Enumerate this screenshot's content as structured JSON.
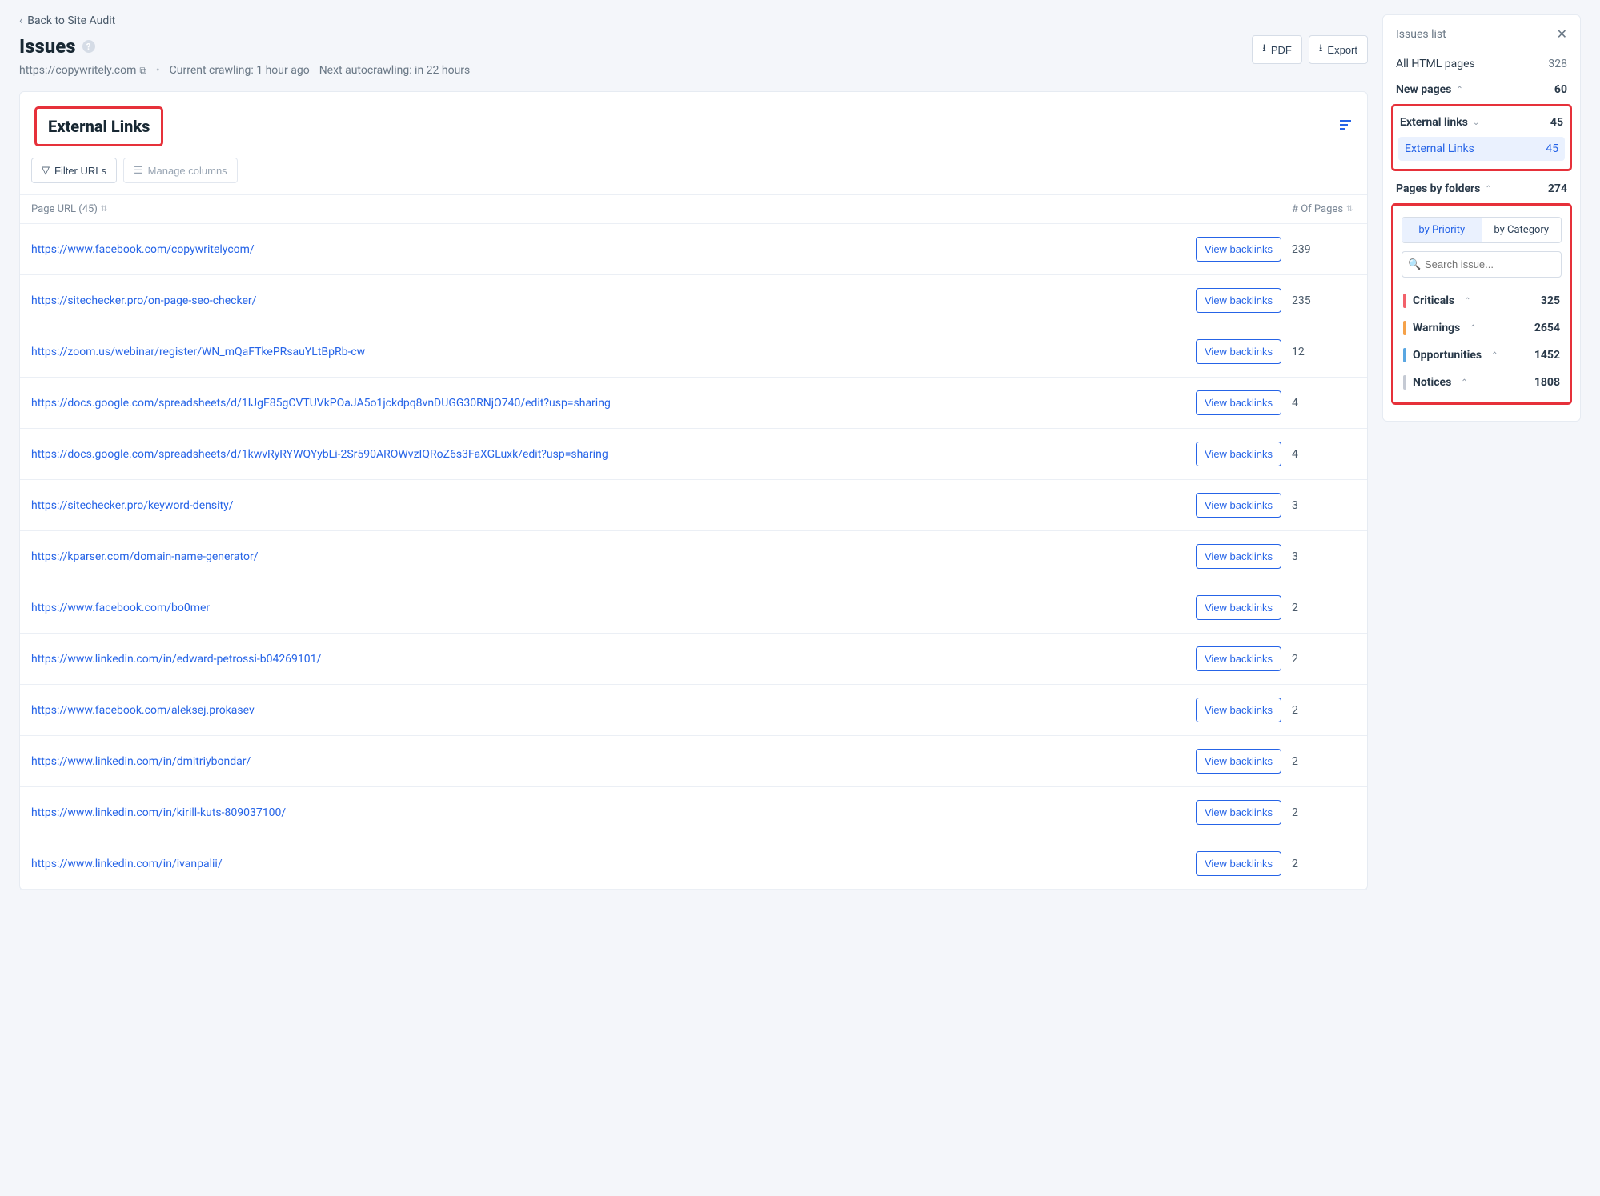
{
  "back_link": "Back to Site Audit",
  "page_title": "Issues",
  "site_url": "https://copywritely.com",
  "crawling_current": "Current crawling: 1 hour ago",
  "crawling_next": "Next autocrawling: in 22 hours",
  "buttons": {
    "pdf": "PDF",
    "export": "Export"
  },
  "card": {
    "title": "External Links",
    "filter": "Filter URLs",
    "manage": "Manage columns"
  },
  "table": {
    "col_url": "Page URL (45)",
    "col_pages": "# Of Pages",
    "view_label": "View backlinks",
    "rows": [
      {
        "url": "https://www.facebook.com/copywritelycom/",
        "pages": "239"
      },
      {
        "url": "https://sitechecker.pro/on-page-seo-checker/",
        "pages": "235"
      },
      {
        "url": "https://zoom.us/webinar/register/WN_mQaFTkePRsauYLtBpRb-cw",
        "pages": "12"
      },
      {
        "url": "https://docs.google.com/spreadsheets/d/1IJgF85gCVTUVkPOaJA5o1jckdpq8vnDUGG30RNjO740/edit?usp=sharing",
        "pages": "4"
      },
      {
        "url": "https://docs.google.com/spreadsheets/d/1kwvRyRYWQYybLi-2Sr590AROWvzIQRoZ6s3FaXGLuxk/edit?usp=sharing",
        "pages": "4"
      },
      {
        "url": "https://sitechecker.pro/keyword-density/",
        "pages": "3"
      },
      {
        "url": "https://kparser.com/domain-name-generator/",
        "pages": "3"
      },
      {
        "url": "https://www.facebook.com/bo0mer",
        "pages": "2"
      },
      {
        "url": "https://www.linkedin.com/in/edward-petrossi-b04269101/",
        "pages": "2"
      },
      {
        "url": "https://www.facebook.com/aleksej.prokasev",
        "pages": "2"
      },
      {
        "url": "https://www.linkedin.com/in/dmitriybondar/",
        "pages": "2"
      },
      {
        "url": "https://www.linkedin.com/in/kirill-kuts-809037100/",
        "pages": "2"
      },
      {
        "url": "https://www.linkedin.com/in/ivanpalii/",
        "pages": "2"
      }
    ]
  },
  "sidebar": {
    "title": "Issues list",
    "all_html": {
      "label": "All HTML pages",
      "count": "328"
    },
    "new_pages": {
      "label": "New pages",
      "count": "60"
    },
    "external": {
      "label": "External links",
      "count": "45",
      "sub_label": "External Links",
      "sub_count": "45"
    },
    "folders": {
      "label": "Pages by folders",
      "count": "274"
    },
    "tabs": {
      "priority": "by Priority",
      "category": "by Category"
    },
    "search_placeholder": "Search issue...",
    "cats": [
      {
        "label": "Criticals",
        "count": "325",
        "color": "#f2616a"
      },
      {
        "label": "Warnings",
        "count": "2654",
        "color": "#f5a24a"
      },
      {
        "label": "Opportunities",
        "count": "1452",
        "color": "#5aa7e2"
      },
      {
        "label": "Notices",
        "count": "1808",
        "color": "#c5cad4"
      }
    ]
  }
}
